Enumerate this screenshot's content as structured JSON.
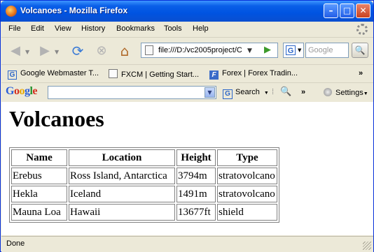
{
  "window": {
    "title": "Volcanoes - Mozilla Firefox"
  },
  "menu": [
    "File",
    "Edit",
    "View",
    "History",
    "Bookmarks",
    "Tools",
    "Help"
  ],
  "nav": {
    "url": "file:///D:/vc2005project/C",
    "search_placeholder": "Google"
  },
  "bookmarks": [
    "Google Webmaster T...",
    "FXCM | Getting Start...",
    "Forex | Forex Tradin..."
  ],
  "google_toolbar": {
    "logo": "Google",
    "search_label": "Search",
    "settings_label": "Settings"
  },
  "page": {
    "heading": "Volcanoes",
    "table": {
      "headers": [
        "Name",
        "Location",
        "Height",
        "Type"
      ],
      "rows": [
        [
          "Erebus",
          "Ross Island, Antarctica",
          "3794m",
          "stratovolcano"
        ],
        [
          "Hekla",
          "Iceland",
          "1491m",
          "stratovolcano"
        ],
        [
          "Mauna Loa",
          "Hawaii",
          "13677ft",
          "shield"
        ]
      ]
    }
  },
  "status": {
    "text": "Done"
  }
}
